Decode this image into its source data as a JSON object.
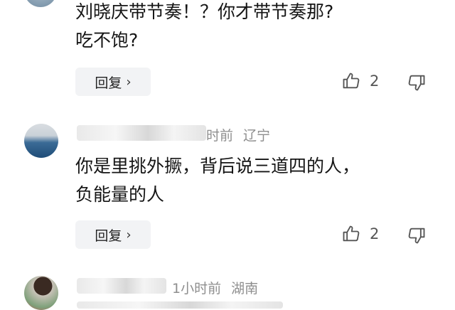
{
  "comments": [
    {
      "time": "",
      "location": "",
      "lines": [
        "刘晓庆带节奏！？你才带节奏那?",
        "吃不饱?"
      ],
      "reply_label": "回复",
      "likes": "2"
    },
    {
      "time": "时前",
      "location": "辽宁",
      "lines": [
        "你是里挑外撅，背后说三道四的人，",
        "负能量的人"
      ],
      "reply_label": "回复",
      "likes": "2"
    },
    {
      "time": "1小时前",
      "location": "湖南",
      "lines": [],
      "reply_label": "",
      "likes": ""
    }
  ],
  "icons": {
    "like": "thumbs-up-icon",
    "dislike": "thumbs-down-icon",
    "chevron": "chevron-right-icon"
  },
  "colors": {
    "reply_bg": "#f2f3f5",
    "meta_gray": "#8e8e8e",
    "text": "#151515"
  }
}
